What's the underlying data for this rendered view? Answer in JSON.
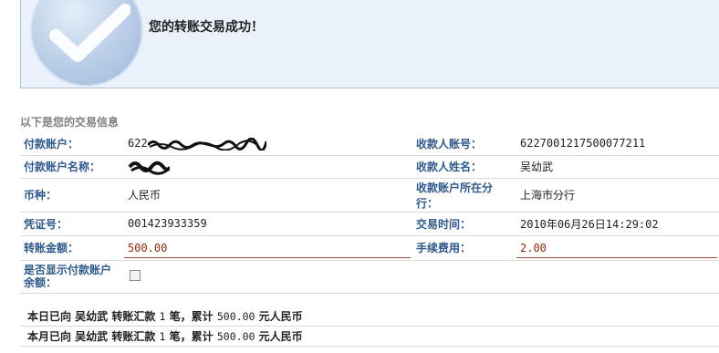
{
  "banner": {
    "message": "您的转账交易成功！"
  },
  "section": {
    "title": "以下是您的交易信息"
  },
  "fields": {
    "payer_account_label": "付款账户：",
    "payer_account_value": "622",
    "payee_account_label": "收款人账号：",
    "payee_account_value": "6227001217500077211",
    "payer_name_label": "付款账户名称：",
    "payee_name_label": "收款人姓名：",
    "payee_name_value": "吴幼武",
    "currency_label": "币种：",
    "currency_value": "人民币",
    "payee_branch_label": "收款账户所在分行：",
    "payee_branch_value": "上海市分行",
    "voucher_label": "凭证号：",
    "voucher_value": "001423933359",
    "time_label": "交易时间：",
    "time_value": "2010年06月26日14:29:02",
    "amount_label": "转账金额：",
    "amount_value": "500.00",
    "fee_label": "手续费用：",
    "fee_value": "2.00",
    "show_balance_label": "是否显示付款账户余额："
  },
  "summary": {
    "today": {
      "prefix": "本日已向 吴幼武 转账汇款",
      "count": "1",
      "mid": "笔，累计",
      "total": "500.00",
      "suffix": "元人民币"
    },
    "month": {
      "prefix": "本月已向 吴幼武 转账汇款",
      "count": "1",
      "mid": "笔，累计",
      "total": "500.00",
      "suffix": "元人民币"
    }
  },
  "colors": {
    "label": "#2f5a8a",
    "amount": "#8b2a08",
    "banner_bg": "#eaf1fa"
  },
  "icons": {
    "banner": "success-checkmark-icon"
  }
}
